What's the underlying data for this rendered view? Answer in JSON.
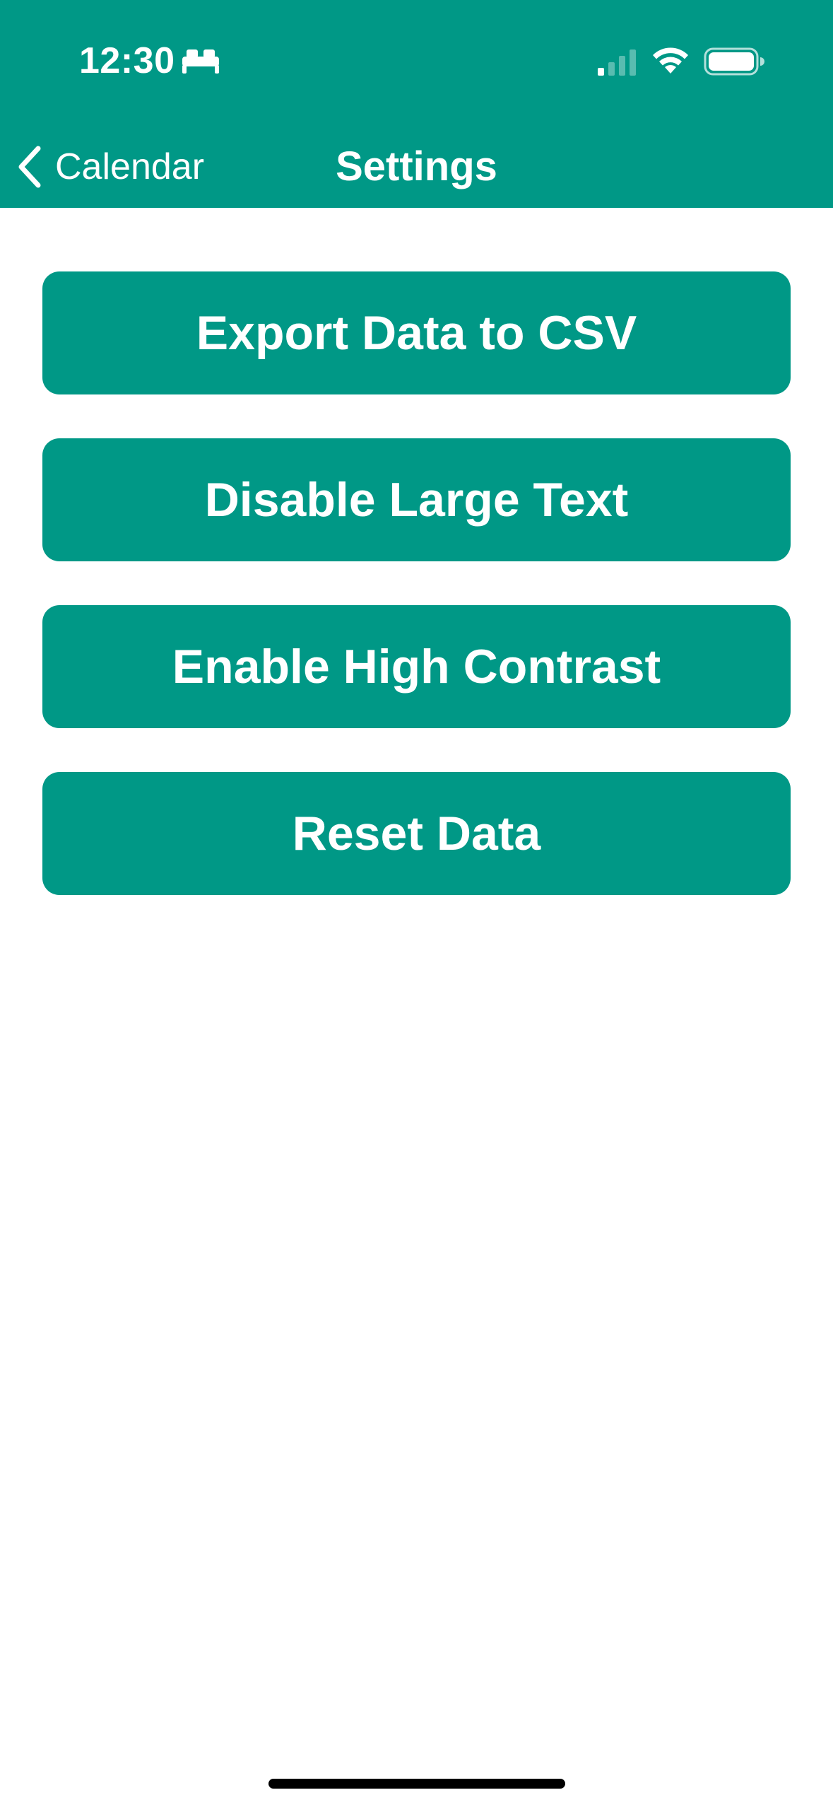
{
  "status_bar": {
    "time": "12:30",
    "sleep_icon": "bed-icon",
    "signal_icon": "cellular-signal-icon",
    "wifi_icon": "wifi-icon",
    "battery_icon": "battery-icon"
  },
  "nav": {
    "back_label": "Calendar",
    "back_icon": "chevron-left-icon",
    "title": "Settings"
  },
  "actions": [
    {
      "label": "Export Data to CSV"
    },
    {
      "label": "Disable Large Text"
    },
    {
      "label": "Enable High Contrast"
    },
    {
      "label": "Reset Data"
    }
  ],
  "colors": {
    "accent": "#009886",
    "background": "#ffffff",
    "on_accent": "#ffffff"
  }
}
